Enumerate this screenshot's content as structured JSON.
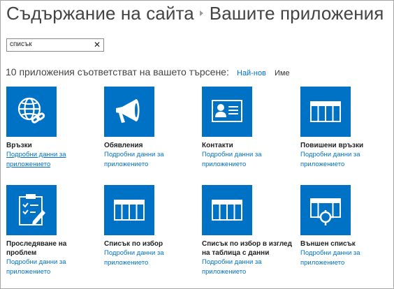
{
  "header": {
    "site_contents": "Съдържание на сайта",
    "your_apps": "Вашите приложения"
  },
  "search": {
    "value": "списък",
    "clear_glyph": "✕"
  },
  "results": {
    "summary": "10 приложения съответстват на вашето търсене:",
    "sort_newest": "Най-нов",
    "sort_name": "Име"
  },
  "apps": [
    {
      "name": "Връзки",
      "details_1": "Подробни данни за",
      "details_2": "приложението",
      "icon": "globe-link-icon"
    },
    {
      "name": "Обявления",
      "details_1": "Подробни данни за",
      "details_2": "приложението",
      "icon": "megaphone-icon"
    },
    {
      "name": "Контакти",
      "details_1": "Подробни данни за",
      "details_2": "приложението",
      "icon": "contact-card-icon"
    },
    {
      "name": "Повишени връзки",
      "details_1": "Подробни данни за",
      "details_2": "приложението",
      "icon": "list-table-icon"
    },
    {
      "name_1": "Проследяване на",
      "name_2": "проблем",
      "details_1": "Подробни данни за",
      "details_2": "приложението",
      "icon": "clipboard-check-icon"
    },
    {
      "name": "Списък по избор",
      "details_1": "Подробни данни за",
      "details_2": "приложението",
      "icon": "list-table-icon"
    },
    {
      "name_1": "Списък по избор в изглед",
      "name_2": "на таблица с данни",
      "details_1": "Подробни данни за",
      "details_2": "приложението",
      "icon": "list-table-icon"
    },
    {
      "name": "Външен списък",
      "details_1": "Подробни данни за",
      "details_2": "приложението",
      "icon": "external-list-icon"
    }
  ],
  "colors": {
    "tile": "#0072c6",
    "link": "#0072c6"
  }
}
